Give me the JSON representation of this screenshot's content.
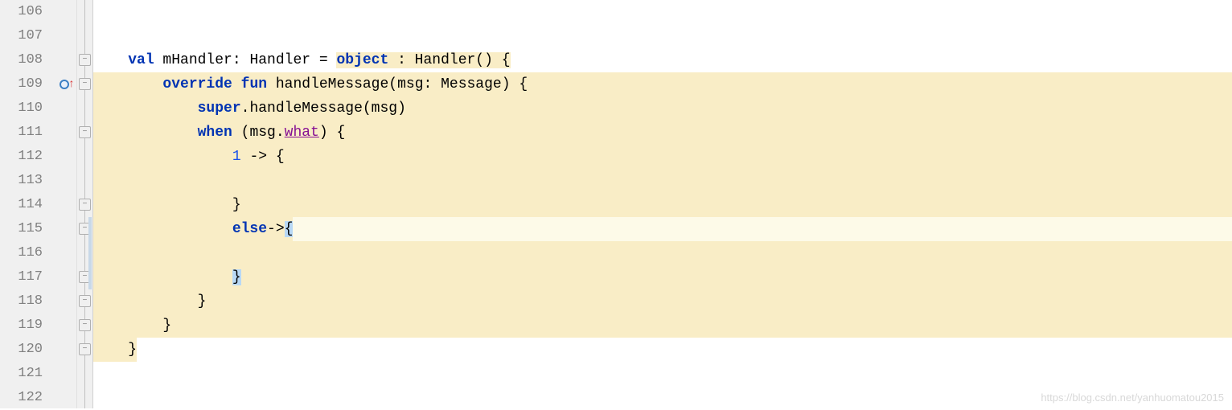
{
  "gutter": {
    "lines": [
      "106",
      "107",
      "108",
      "109",
      "110",
      "111",
      "112",
      "113",
      "114",
      "115",
      "116",
      "117",
      "118",
      "119",
      "120",
      "121",
      "122"
    ]
  },
  "code": {
    "l108": {
      "pre": "    ",
      "val": "val",
      "name": " mHandler: Handler = ",
      "object": "object",
      "tail": " : Handler() {"
    },
    "l109": {
      "pre": "        ",
      "override": "override",
      "sp1": " ",
      "fun": "fun",
      "rest": " handleMessage(msg: Message) {"
    },
    "l110": {
      "pre": "            ",
      "super": "super",
      "rest": ".handleMessage(msg)"
    },
    "l111": {
      "pre": "            ",
      "when": "when",
      "open": " (msg.",
      "what": "what",
      "close": ") {"
    },
    "l112": {
      "pre": "                ",
      "num": "1",
      "rest": " -> {"
    },
    "l113": {
      "pre": ""
    },
    "l114": {
      "pre": "                ",
      "brace": "}"
    },
    "l115": {
      "pre": "                ",
      "else": "else",
      "arrow": "->",
      "brace": "{"
    },
    "l116": {
      "pre": ""
    },
    "l117": {
      "pre": "                ",
      "brace": "}"
    },
    "l118": {
      "pre": "            ",
      "brace": "}"
    },
    "l119": {
      "pre": "        ",
      "brace": "}"
    },
    "l120": {
      "pre": "    ",
      "brace": "}"
    }
  },
  "watermark": "https://blog.csdn.net/yanhuomatou2015"
}
